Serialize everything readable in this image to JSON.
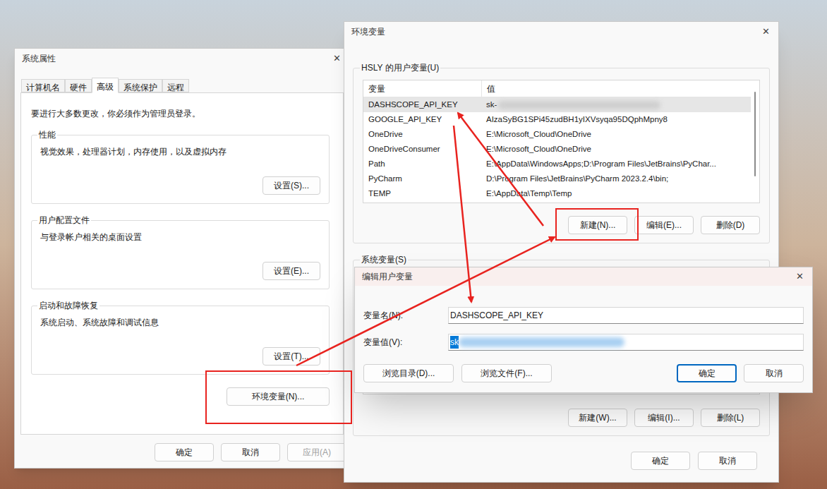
{
  "system_properties": {
    "title": "系统属性",
    "close": "✕",
    "tabs": [
      {
        "label": "计算机名",
        "selected": false
      },
      {
        "label": "硬件",
        "selected": false
      },
      {
        "label": "高级",
        "selected": true
      },
      {
        "label": "系统保护",
        "selected": false
      },
      {
        "label": "远程",
        "selected": false
      }
    ],
    "notice": "要进行大多数更改，你必须作为管理员登录。",
    "groups": [
      {
        "label": "性能",
        "description": "视觉效果，处理器计划，内存使用，以及虚拟内存",
        "button": "设置(S)..."
      },
      {
        "label": "用户配置文件",
        "description": "与登录帐户相关的桌面设置",
        "button": "设置(E)..."
      },
      {
        "label": "启动和故障恢复",
        "description": "系统启动、系统故障和调试信息",
        "button": "设置(T)..."
      }
    ],
    "env_button": "环境变量(N)...",
    "buttons": [
      {
        "label": "确定",
        "disabled": false
      },
      {
        "label": "取消",
        "disabled": false
      },
      {
        "label": "应用(A)",
        "disabled": true
      }
    ]
  },
  "environment_variables": {
    "title": "环境变量",
    "close": "✕",
    "user_group": {
      "label": "HSLY 的用户变量(U)",
      "columns": [
        "变量",
        "值"
      ],
      "rows": [
        {
          "name": "DASHSCOPE_API_KEY",
          "value": "sk-",
          "redacted": true,
          "selected": true
        },
        {
          "name": "GOOGLE_API_KEY",
          "value": "AIzaSyBG1SPi45zudBH1yIXVsyqa95DQphMpny8",
          "redacted": false,
          "selected": false
        },
        {
          "name": "OneDrive",
          "value": "E:\\Microsoft_Cloud\\OneDrive",
          "redacted": false,
          "selected": false
        },
        {
          "name": "OneDriveConsumer",
          "value": "E:\\Microsoft_Cloud\\OneDrive",
          "redacted": false,
          "selected": false
        },
        {
          "name": "Path",
          "value": "E:\\AppData\\WindowsApps;D:\\Program Files\\JetBrains\\PyChar...",
          "redacted": false,
          "selected": false
        },
        {
          "name": "PyCharm",
          "value": "D:\\Program Files\\JetBrains\\PyCharm 2023.2.4\\bin;",
          "redacted": false,
          "selected": false
        },
        {
          "name": "TEMP",
          "value": "E:\\AppData\\Temp\\Temp",
          "redacted": false,
          "selected": false
        }
      ],
      "buttons": [
        "新建(N)...",
        "编辑(E)...",
        "删除(D)"
      ]
    },
    "system_group": {
      "label": "系统变量(S)",
      "buttons": [
        "新建(W)...",
        "编辑(I)...",
        "删除(L)"
      ]
    },
    "buttons": [
      "确定",
      "取消"
    ]
  },
  "edit_user_variable": {
    "title": "编辑用户变量",
    "close": "✕",
    "fields": [
      {
        "label": "变量名(N):",
        "value": "DASHSCOPE_API_KEY",
        "selected": false,
        "redacted": false
      },
      {
        "label": "变量值(V):",
        "value": "sk",
        "selected": true,
        "redacted": true
      }
    ],
    "left_buttons": [
      {
        "label": "浏览目录(D)...",
        "default": false
      },
      {
        "label": "浏览文件(F)...",
        "default": false
      }
    ],
    "right_buttons": [
      {
        "label": "确定",
        "default": true
      },
      {
        "label": "取消",
        "default": false
      }
    ]
  }
}
